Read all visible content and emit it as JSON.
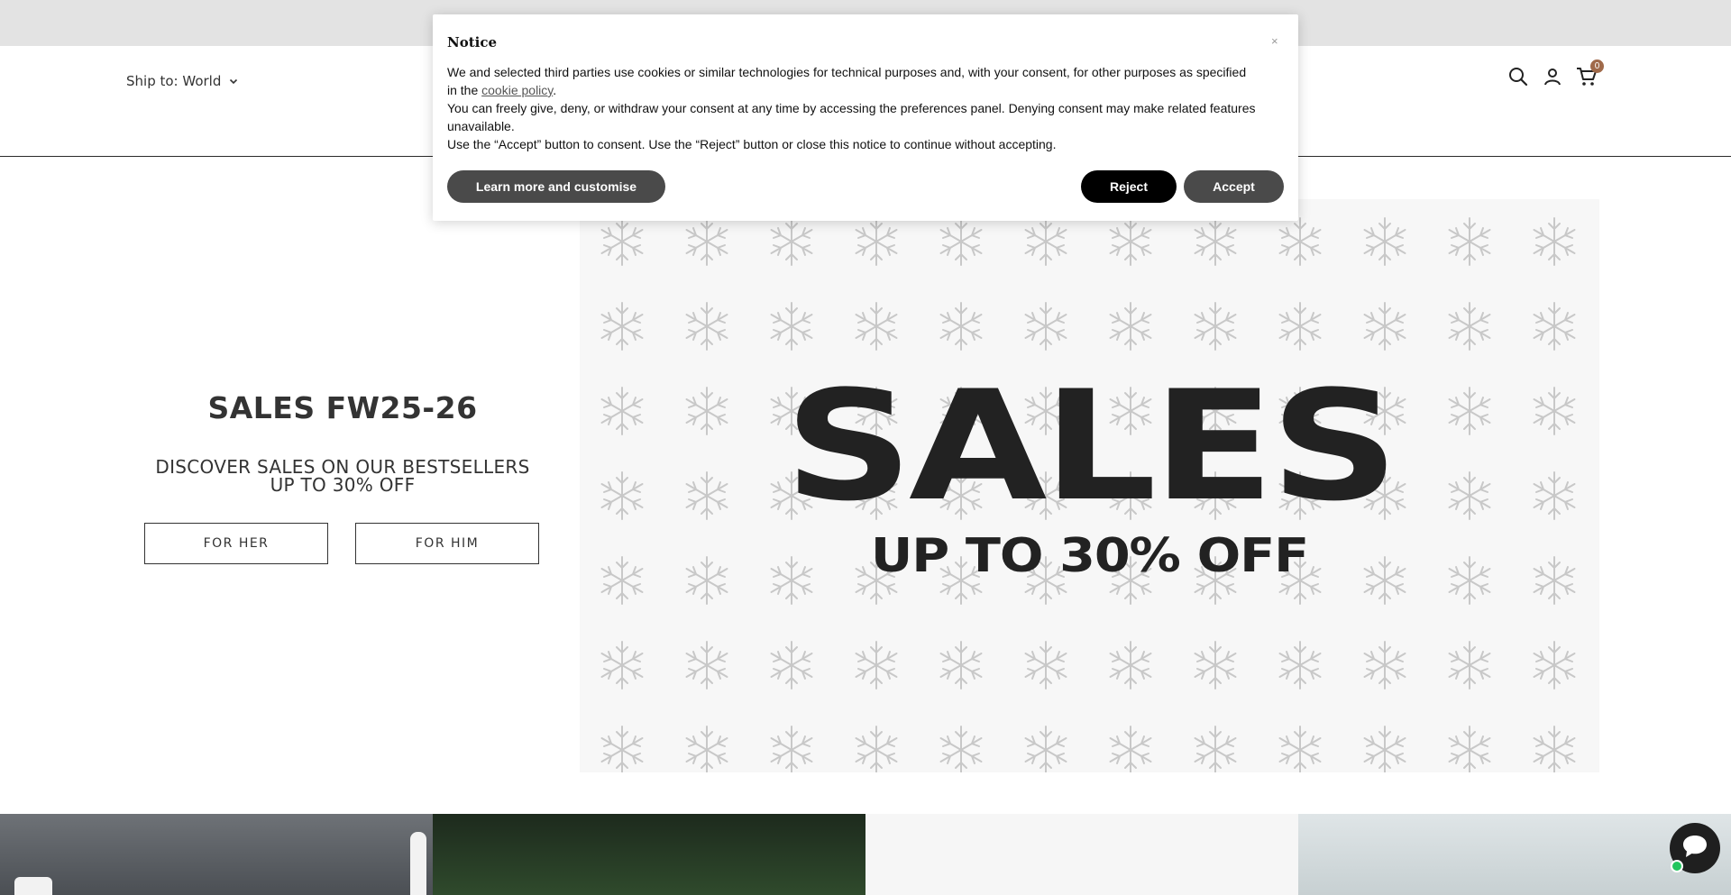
{
  "header": {
    "ship_to_label": "Ship to: World",
    "icons": [
      "search-icon",
      "account-icon",
      "cart-icon",
      "chevron-down-icon"
    ],
    "cart_count": "0",
    "cart_badge_color": "#a06a4a"
  },
  "hero": {
    "title": "SALES FW25-26",
    "subtitle_line1": "DISCOVER SALES ON OUR BESTSELLERS",
    "subtitle_line2": "UP TO 30% OFF",
    "button_her": "FOR HER",
    "button_him": "FOR HIM",
    "banner_big": "SALES",
    "banner_small": "UP TO 30% OFF"
  },
  "cookie_notice": {
    "title": "Notice",
    "close_symbol": "×",
    "text_1_before_link": "We and selected third parties use cookies or similar technologies for technical purposes and, with your consent, for other purposes as specified in the ",
    "text_1_link": "cookie policy",
    "text_1_after_link": ".",
    "text_2": "You can freely give, deny, or withdraw your consent at any time by accessing the preferences panel. Denying consent may make related features unavailable.",
    "text_3": "Use the “Accept” button to consent. Use the “Reject” button or close this notice to continue without accepting.",
    "learn_more_label": "Learn more and customise",
    "reject_label": "Reject",
    "accept_label": "Accept"
  },
  "colors": {
    "top_bar": "#e3e3e3",
    "button_dark": "#4a4a4a",
    "button_black": "#000000",
    "chat_online": "#22c55e"
  }
}
